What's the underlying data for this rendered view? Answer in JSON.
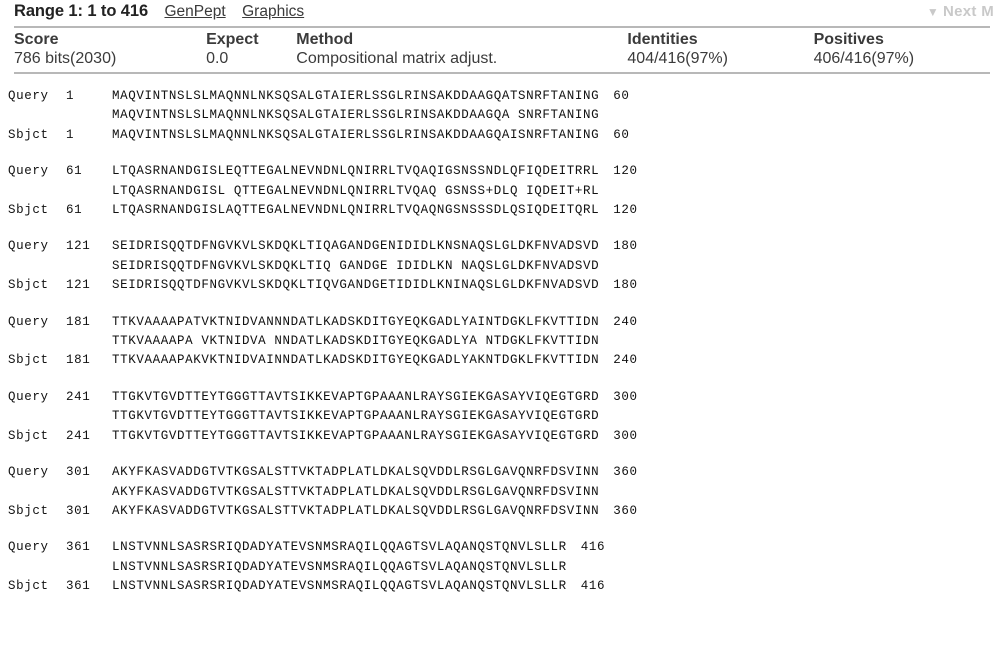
{
  "range_bar": {
    "title": "Range 1: 1 to 416",
    "links": [
      "GenPept",
      "Graphics"
    ],
    "next_match": "Next M",
    "next_match_icon": "triangle-down-icon"
  },
  "score_table": {
    "headers": [
      "Score",
      "Expect",
      "Method",
      "Identities",
      "Positives"
    ],
    "values": [
      "786 bits(2030)",
      "0.0",
      "Compositional matrix adjust.",
      "404/416(97%)",
      "406/416(97%)"
    ]
  },
  "alignment": {
    "query_label": "Query",
    "subject_label": "Sbjct",
    "blocks": [
      {
        "query_start": "1",
        "query_seq": "MAQVINTNSLSLMAQNNLNKSQSALGTAIERLSSGLRINSAKDDAAGQATSNRFTANING",
        "query_end": "60",
        "midline": "MAQVINTNSLSLMAQNNLNKSQSALGTAIERLSSGLRINSAKDDAAGQA SNRFTANING",
        "subject_start": "1",
        "subject_seq": "MAQVINTNSLSLMAQNNLNKSQSALGTAIERLSSGLRINSAKDDAAGQAISNRFTANING",
        "subject_end": "60"
      },
      {
        "query_start": "61",
        "query_seq": "LTQASRNANDGISLEQTTEGALNEVNDNLQNIRRLTVQAQIGSNSSNDLQFIQDEITRRL",
        "query_end": "120",
        "midline": "LTQASRNANDGISL QTTEGALNEVNDNLQNIRRLTVQAQ GSNSS+DLQ IQDEIT+RL",
        "subject_start": "61",
        "subject_seq": "LTQASRNANDGISLAQTTEGALNEVNDNLQNIRRLTVQAQNGSNSSSDLQSIQDEITQRL",
        "subject_end": "120"
      },
      {
        "query_start": "121",
        "query_seq": "SEIDRISQQTDFNGVKVLSKDQKLTIQAGANDGENIDIDLKNSNAQSLGLDKFNVADSVD",
        "query_end": "180",
        "midline": "SEIDRISQQTDFNGVKVLSKDQKLTIQ GANDGE IDIDLKN NAQSLGLDKFNVADSVD",
        "subject_start": "121",
        "subject_seq": "SEIDRISQQTDFNGVKVLSKDQKLTIQVGANDGETIDIDLKNINAQSLGLDKFNVADSVD",
        "subject_end": "180"
      },
      {
        "query_start": "181",
        "query_seq": "TTKVAAAAPATVKTNIDVANNNDATLKADSKDITGYEQKGADLYAINTDGKLFKVTTIDN",
        "query_end": "240",
        "midline": "TTKVAAAAPA VKTNIDVA NNDATLKADSKDITGYEQKGADLYA NTDGKLFKVTTIDN",
        "subject_start": "181",
        "subject_seq": "TTKVAAAAPAKVKTNIDVAINNDATLKADSKDITGYEQKGADLYAKNTDGKLFKVTTIDN",
        "subject_end": "240"
      },
      {
        "query_start": "241",
        "query_seq": "TTGKVTGVDTTEYTGGGTTAVTSIKKEVAPTGPAAANLRAYSGIEKGASAYVIQEGTGRD",
        "query_end": "300",
        "midline": "TTGKVTGVDTTEYTGGGTTAVTSIKKEVAPTGPAAANLRAYSGIEKGASAYVIQEGTGRD",
        "subject_start": "241",
        "subject_seq": "TTGKVTGVDTTEYTGGGTTAVTSIKKEVAPTGPAAANLRAYSGIEKGASAYVIQEGTGRD",
        "subject_end": "300"
      },
      {
        "query_start": "301",
        "query_seq": "AKYFKASVADDGTVTKGSALSTTVKTADPLATLDKALSQVDDLRSGLGAVQNRFDSVINN",
        "query_end": "360",
        "midline": "AKYFKASVADDGTVTKGSALSTTVKTADPLATLDKALSQVDDLRSGLGAVQNRFDSVINN",
        "subject_start": "301",
        "subject_seq": "AKYFKASVADDGTVTKGSALSTTVKTADPLATLDKALSQVDDLRSGLGAVQNRFDSVINN",
        "subject_end": "360"
      },
      {
        "query_start": "361",
        "query_seq": "LNSTVNNLSASRSRIQDADYATEVSNMSRAQILQQAGTSVLAQANQSTQNVLSLLR",
        "query_end": "416",
        "midline": "LNSTVNNLSASRSRIQDADYATEVSNMSRAQILQQAGTSVLAQANQSTQNVLSLLR",
        "subject_start": "361",
        "subject_seq": "LNSTVNNLSASRSRIQDADYATEVSNMSRAQILQQAGTSVLAQANQSTQNVLSLLR",
        "subject_end": "416"
      }
    ]
  }
}
